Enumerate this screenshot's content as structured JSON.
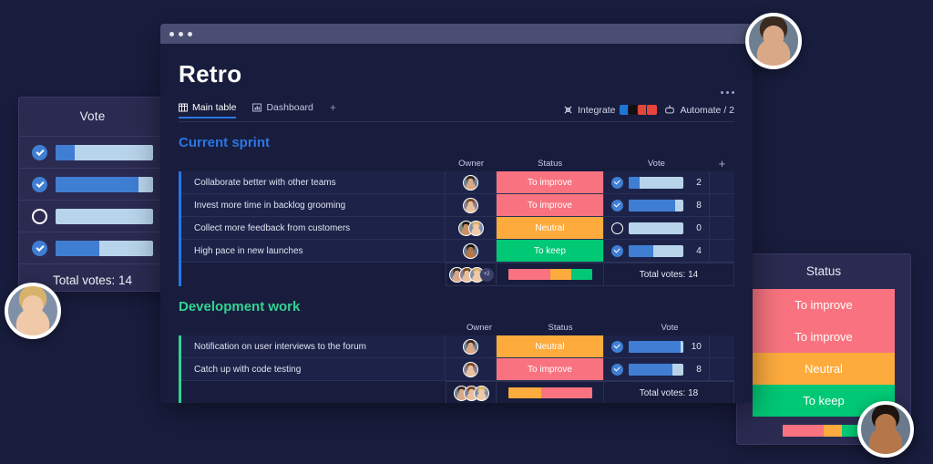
{
  "window": {
    "title": "Retro",
    "menu_icon": "kebab-menu-icon",
    "dots": [
      "close-dot",
      "minimize-dot",
      "maximize-dot"
    ]
  },
  "tabs": [
    {
      "label": "Main table",
      "icon": "table-icon",
      "active": true
    },
    {
      "label": "Dashboard",
      "icon": "chart-icon",
      "active": false
    }
  ],
  "tab_add": "+",
  "toolbar": {
    "integrate_label": "Integrate",
    "integrate_icon": "integrate-icon",
    "automate_label": "Automate / 2",
    "automate_icon": "robot-icon",
    "app_icons": [
      "#1f76d2",
      "#111111",
      "#e0473a",
      "#e8453c"
    ]
  },
  "columns": {
    "owner": "Owner",
    "status": "Status",
    "vote": "Vote",
    "add": "+"
  },
  "colors": {
    "to_improve": "#f8737f",
    "neutral": "#fdab3d",
    "to_keep": "#00c875",
    "vote_fill": "#3f7ed3",
    "vote_track": "#b8d4ea",
    "accent_blue": "#2b76e5",
    "accent_green": "#33d391"
  },
  "groups": [
    {
      "name": "Current sprint",
      "color": "#2b76e5",
      "rows": [
        {
          "name": "Collaborate better with other teams",
          "status": "To improve",
          "status_color": "#f8737f",
          "vote": "2",
          "vote_pct": 20,
          "checked": true
        },
        {
          "name": "Invest more time in backlog grooming",
          "status": "To improve",
          "status_color": "#f8737f",
          "vote": "8",
          "vote_pct": 85,
          "checked": true
        },
        {
          "name": "Collect more feedback from customers",
          "status": "Neutral",
          "status_color": "#fdab3d",
          "vote": "0",
          "vote_pct": 0,
          "checked": false
        },
        {
          "name": "High pace in new  launches",
          "status": "To keep",
          "status_color": "#00c875",
          "vote": "4",
          "vote_pct": 45,
          "checked": true
        }
      ],
      "summary": {
        "total_label": "Total votes: 14",
        "segments": [
          {
            "color": "#f8737f",
            "pct": 50
          },
          {
            "color": "#fdab3d",
            "pct": 25
          },
          {
            "color": "#00c875",
            "pct": 25
          }
        ],
        "avatar_extra": "+2"
      }
    },
    {
      "name": "Development work",
      "color": "#33d391",
      "rows": [
        {
          "name": "Notification on user interviews to the forum",
          "status": "Neutral",
          "status_color": "#fdab3d",
          "vote": "10",
          "vote_pct": 95,
          "checked": true
        },
        {
          "name": "Catch up with code testing",
          "status": "To improve",
          "status_color": "#f8737f",
          "vote": "8",
          "vote_pct": 80,
          "checked": true
        }
      ],
      "summary": {
        "total_label": "Total votes: 18",
        "segments": [
          {
            "color": "#fdab3d",
            "pct": 40
          },
          {
            "color": "#f8737f",
            "pct": 60
          }
        ],
        "avatar_extra": ""
      }
    }
  ],
  "vote_panel": {
    "title": "Vote",
    "rows": [
      {
        "checked": true,
        "pct": 20
      },
      {
        "checked": true,
        "pct": 85
      },
      {
        "checked": false,
        "pct": 0
      },
      {
        "checked": true,
        "pct": 45
      }
    ],
    "total_label": "Total votes: 14"
  },
  "status_panel": {
    "title": "Status",
    "chips": [
      {
        "label": "To improve",
        "color": "#f8737f"
      },
      {
        "label": "To improve",
        "color": "#f8737f"
      },
      {
        "label": "Neutral",
        "color": "#fdab3d"
      },
      {
        "label": "To keep",
        "color": "#00c875"
      }
    ],
    "segments": [
      {
        "color": "#f8737f",
        "pct": 50
      },
      {
        "color": "#fdab3d",
        "pct": 22
      },
      {
        "color": "#00c875",
        "pct": 28
      }
    ]
  },
  "avatars": {
    "floating": [
      "man-glasses-avatar",
      "woman-blonde-avatar",
      "man-bandana-avatar"
    ]
  }
}
